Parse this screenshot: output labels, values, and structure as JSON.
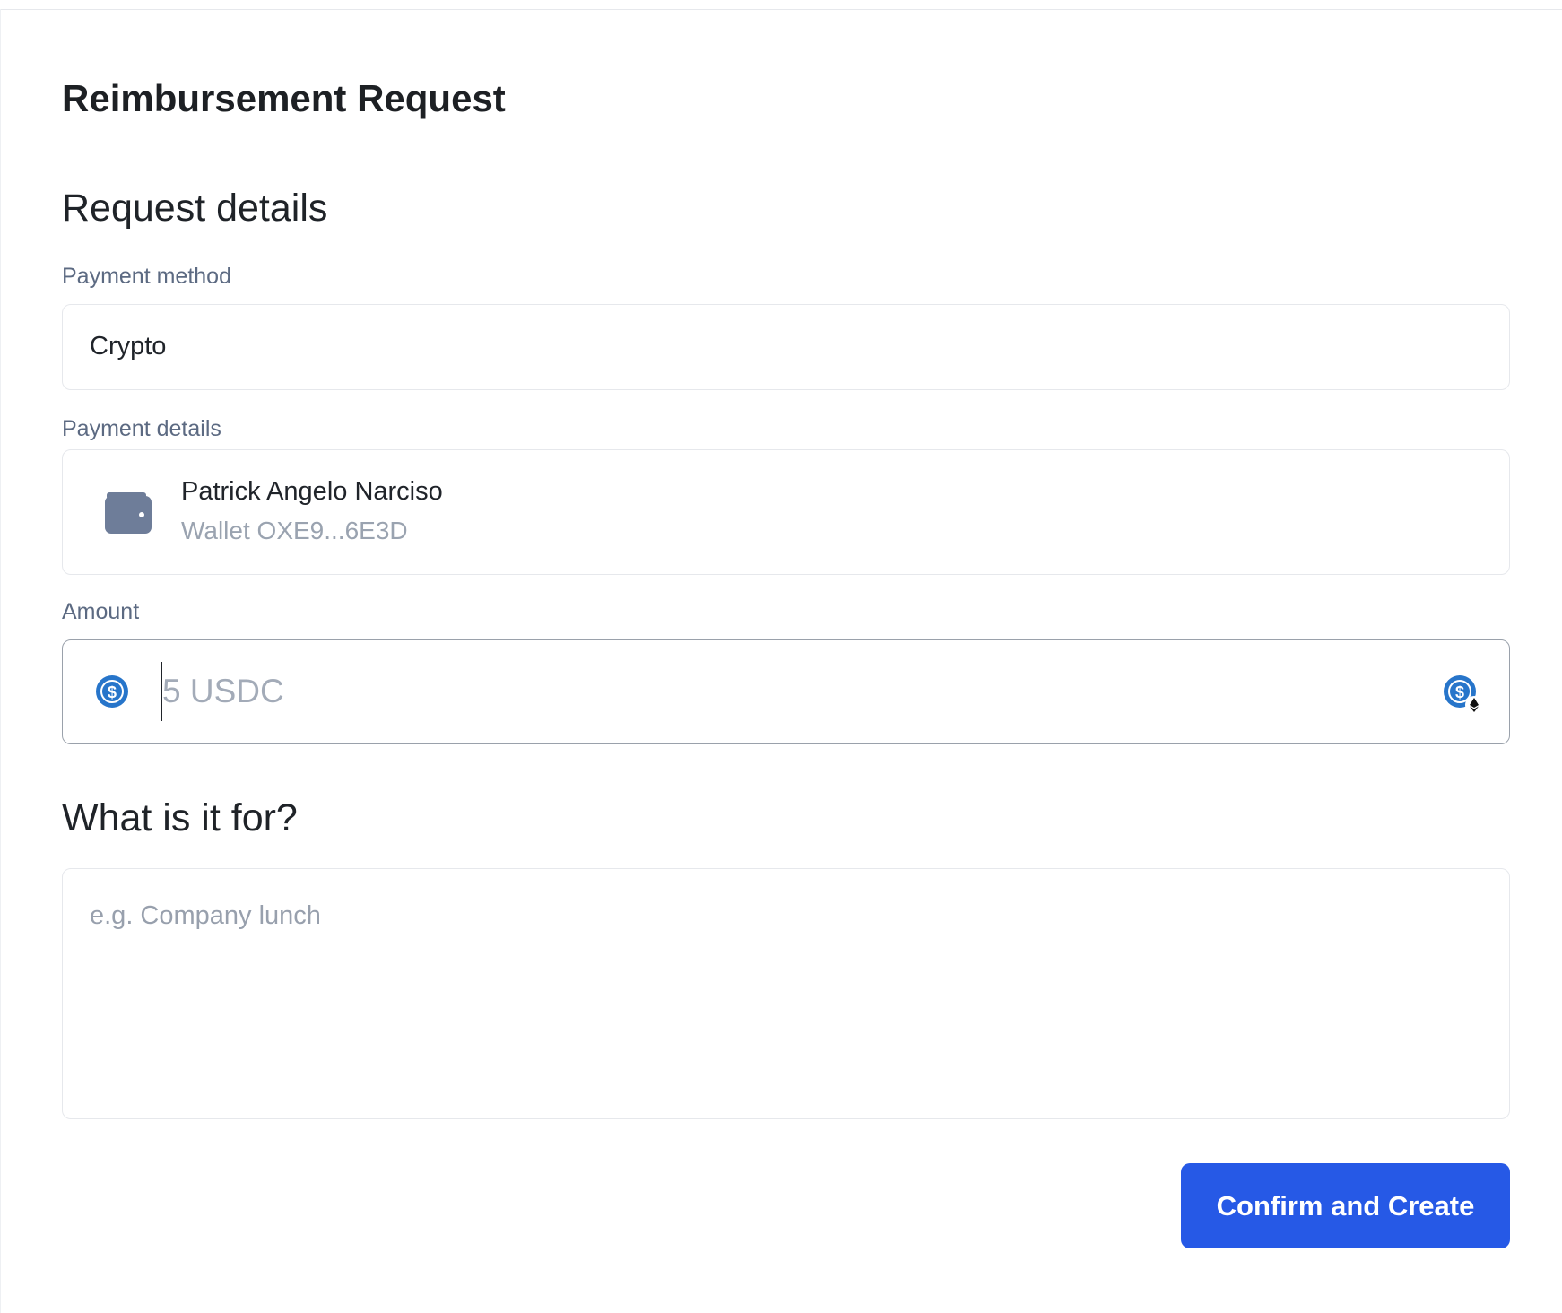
{
  "form": {
    "title": "Reimbursement Request",
    "request_section_title": "Request details",
    "payment_method": {
      "label": "Payment method",
      "value": "Crypto"
    },
    "payment_details": {
      "label": "Payment details",
      "name": "Patrick Angelo Narciso",
      "wallet": "Wallet OXE9...6E3D",
      "icon": "wallet-icon"
    },
    "amount": {
      "label": "Amount",
      "placeholder": "5 USDC",
      "value": "",
      "currency_icon": "usdc-icon",
      "network_icon": "ethereum-icon"
    },
    "purpose": {
      "title": "What is it for?",
      "placeholder": "e.g. Company lunch",
      "value": ""
    },
    "submit_label": "Confirm and Create"
  },
  "colors": {
    "primary_button": "#2659e6",
    "label_text": "#5c6a82",
    "muted_text": "#9aa3b0",
    "usdc_blue": "#2775ca",
    "wallet_icon": "#6e7d99"
  }
}
